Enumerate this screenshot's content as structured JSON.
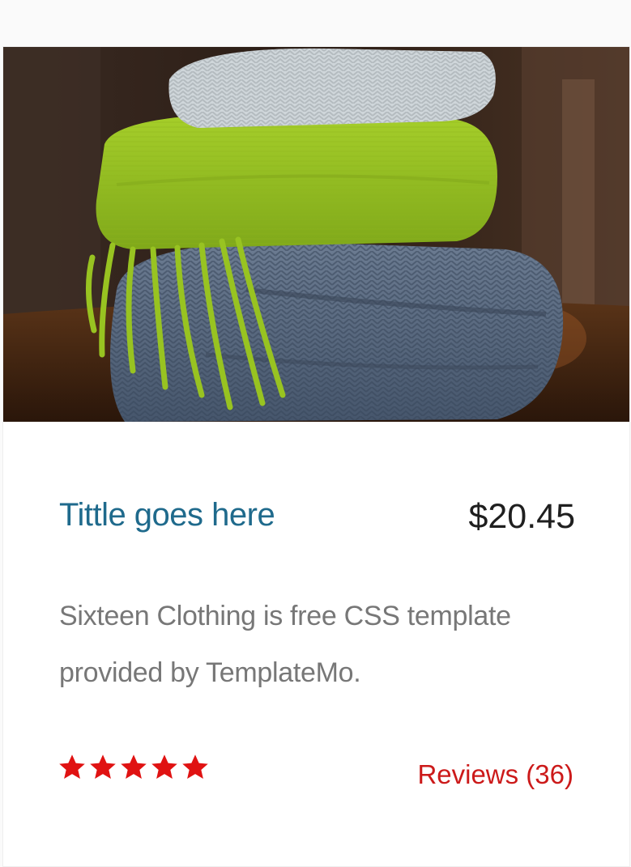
{
  "product": {
    "image_alt": "stack of knitted scarves",
    "title": "Tittle goes here",
    "price": "$20.45",
    "description": "Sixteen Clothing is free CSS template provided by TemplateMo.",
    "rating": {
      "value": 5,
      "max": 5,
      "icon": "star-icon",
      "color": "#e01212"
    },
    "reviews_label": "Reviews (36)"
  },
  "colors": {
    "title": "#1f6a8c",
    "price": "#1f1f1f",
    "description": "#777777",
    "reviews": "#cc1a1a"
  }
}
